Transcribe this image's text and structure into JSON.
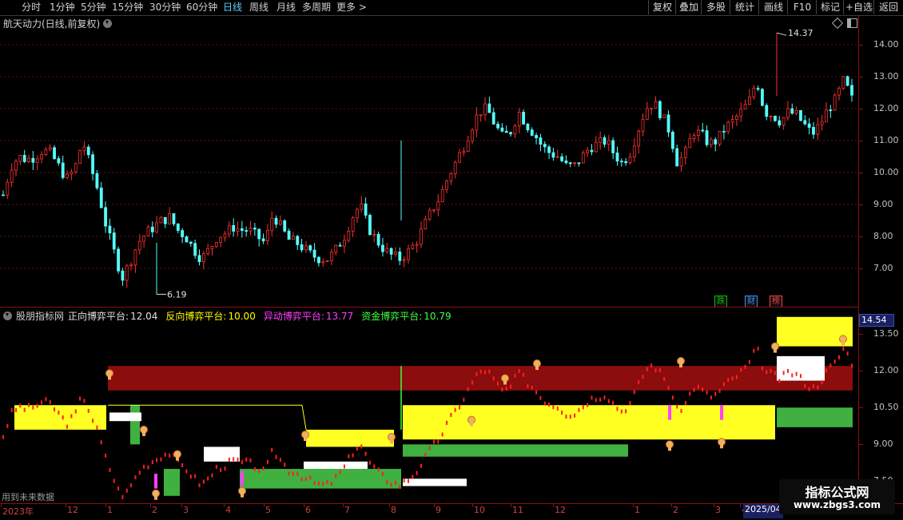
{
  "toolbar": {
    "timeframes": [
      "分时",
      "1分钟",
      "5分钟",
      "15分钟",
      "30分钟",
      "60分钟",
      "日线",
      "周线",
      "月线",
      "多周期",
      "更多 >"
    ],
    "active_timeframe": "日线",
    "right_buttons": [
      "复权",
      "叠加",
      "多股",
      "统计",
      "画线",
      "F10",
      "标记",
      "+自选",
      "返回"
    ]
  },
  "main_chart": {
    "title": "航天动力(日线,前复权)",
    "high_label": "14.37",
    "low_label": "6.19",
    "price_ticks": [
      "14.00",
      "13.00",
      "12.00",
      "11.00",
      "10.00",
      "9.00",
      "8.00",
      "7.00"
    ],
    "badges": [
      "跌",
      "财",
      "榜"
    ],
    "badge_colors": [
      "#00c000",
      "#4090ff",
      "#ff4040"
    ]
  },
  "indicator": {
    "name": "股朋指标网",
    "values": [
      {
        "label": "正向博弈平台:",
        "value": "12.04",
        "color": "#e0e0e0"
      },
      {
        "label": "反向博弈平台:",
        "value": "10.00",
        "color": "#ffff00"
      },
      {
        "label": "异动博弈平台:",
        "value": "13.77",
        "color": "#ff40ff"
      },
      {
        "label": "资金博弈平台:",
        "value": "10.79",
        "color": "#40ff40"
      }
    ],
    "current_price": "14.54",
    "price_ticks": [
      "13.50",
      "12.00",
      "10.50",
      "9.00",
      "7.50"
    ],
    "future_note": "用到未来数据"
  },
  "date_axis": {
    "labels": [
      "2023年",
      "12",
      "1",
      "2",
      "3",
      "4",
      "5",
      "6",
      "7",
      "8",
      "9",
      "10",
      "11",
      "12",
      "1",
      "2",
      "3",
      "4",
      "2025/04"
    ]
  },
  "watermark": {
    "title": "指标公式网",
    "url": "www.zbgs3.com"
  },
  "chart_data": {
    "type": "candlestick",
    "title": "航天动力(日线,前复权)",
    "xlabel": "",
    "ylabel": "",
    "ylim": [
      6.0,
      14.6
    ],
    "grid": true,
    "x_labels": [
      "2023年",
      "12",
      "1",
      "2",
      "3",
      "4",
      "5",
      "6",
      "7",
      "8",
      "9",
      "10",
      "11",
      "12",
      "1",
      "2",
      "3",
      "4",
      "2025/04"
    ],
    "series": [
      {
        "values": [
          9.3,
          10.2,
          10.5,
          10.4,
          10.5,
          10.7,
          10.6,
          10.2,
          9.8,
          10.1,
          11.0,
          10.2,
          9.4,
          8.3,
          7.5,
          6.7,
          7.2,
          7.8,
          8.1,
          8.3,
          8.5,
          8.6,
          8.2,
          8.0,
          7.6,
          7.3,
          7.6,
          8.0,
          8.1,
          8.3,
          8.2,
          8.2,
          8.0,
          7.8,
          8.7,
          8.3,
          7.9,
          7.8,
          7.6,
          7.4,
          7.3,
          7.3,
          7.6,
          8.0,
          8.6,
          9.0,
          8.3,
          7.9,
          7.6,
          7.4,
          7.3,
          7.5,
          7.8,
          8.3,
          8.8,
          9.2,
          9.8,
          10.3,
          10.8,
          11.4,
          11.9,
          12.0,
          11.5,
          11.1,
          11.3,
          11.9,
          11.5,
          11.2,
          10.8,
          10.6,
          10.5,
          10.2,
          10.2,
          10.5,
          10.8,
          10.9,
          11.0,
          10.6,
          10.3,
          10.6,
          11.3,
          12.0,
          12.2,
          11.8,
          11.3,
          10.3,
          10.6,
          11.3,
          11.2,
          10.9,
          11.0,
          11.4,
          11.6,
          11.9,
          12.2,
          12.9,
          11.9,
          11.8,
          11.6,
          11.9,
          11.8,
          11.5,
          11.2,
          11.5,
          12.0,
          12.3,
          12.9,
          12.3
        ],
        "low": 6.19,
        "high": 14.37
      }
    ]
  }
}
